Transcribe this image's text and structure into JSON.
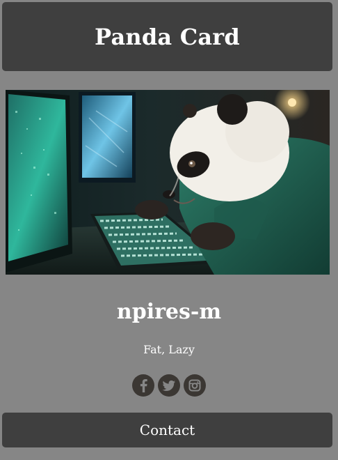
{
  "header": {
    "title": "Panda Card"
  },
  "profile": {
    "image_alt": "Panda typing on a keyboard in front of computer monitors",
    "name": "npires-m",
    "description": "Fat, Lazy"
  },
  "socials": [
    {
      "icon": "facebook-icon"
    },
    {
      "icon": "twitter-icon"
    },
    {
      "icon": "instagram-icon"
    }
  ],
  "contact": {
    "label": "Contact"
  },
  "colors": {
    "background": "#868686",
    "panel": "#3f3f3f",
    "text": "#ffffff",
    "social_icon": "#3b3733"
  }
}
